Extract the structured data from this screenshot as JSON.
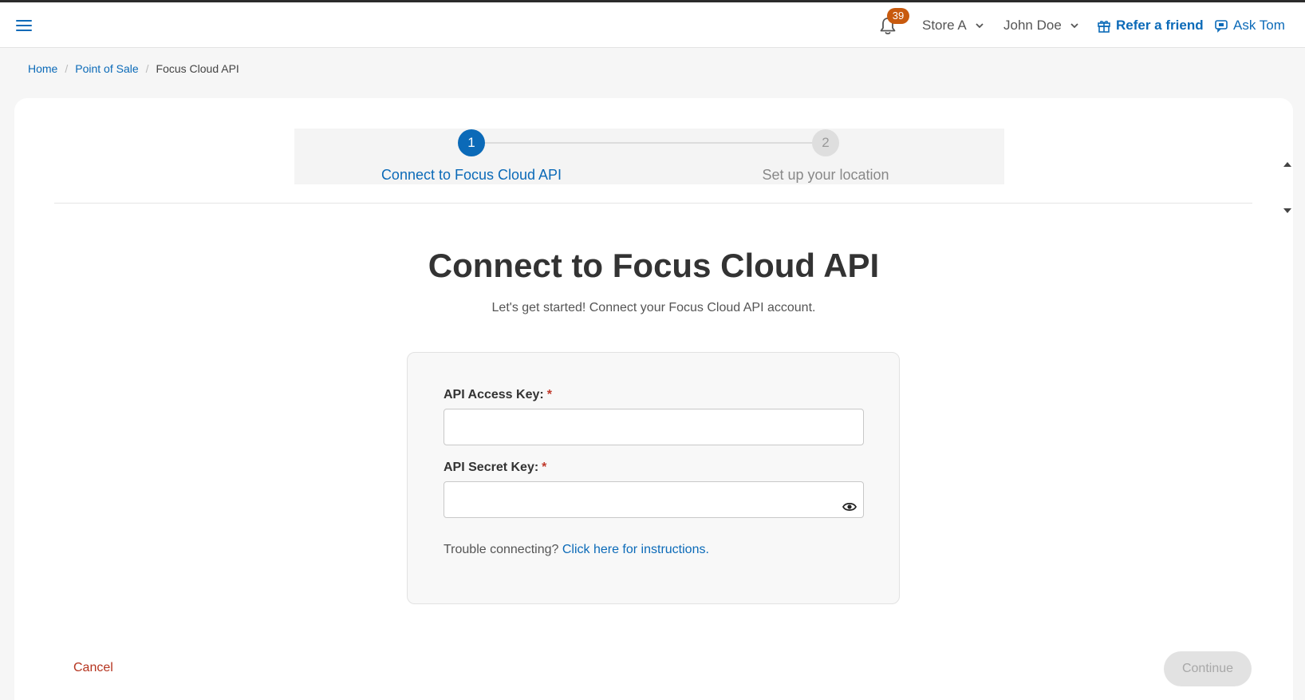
{
  "header": {
    "notifications_count": "39",
    "store_selector": "Store A",
    "user_menu": "John Doe",
    "refer_link": "Refer a friend",
    "ask_link": "Ask Tom"
  },
  "breadcrumb": {
    "home": "Home",
    "section": "Point of Sale",
    "current": "Focus Cloud API"
  },
  "stepper": {
    "steps": [
      {
        "number": "1",
        "label": "Connect to Focus Cloud API"
      },
      {
        "number": "2",
        "label": "Set up your location"
      }
    ]
  },
  "main": {
    "title": "Connect to Focus Cloud API",
    "subtitle": "Let's get started! Connect your Focus Cloud API account."
  },
  "form": {
    "access_key_label": "API Access Key:",
    "access_key_value": "",
    "secret_key_label": "API Secret Key:",
    "secret_key_value": "",
    "required_marker": "*",
    "help_text": "Trouble connecting?",
    "help_link": "Click here for instructions."
  },
  "actions": {
    "cancel_label": "Cancel",
    "continue_label": "Continue"
  },
  "colors": {
    "accent": "#0b6ab8",
    "badge": "#c85a0e",
    "cancel": "#b5341f"
  }
}
